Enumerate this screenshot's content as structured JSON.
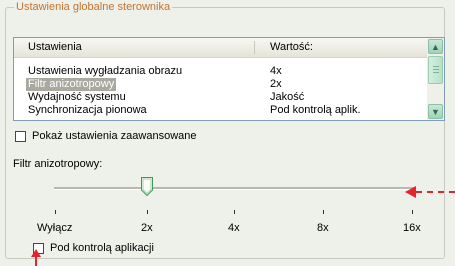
{
  "group": {
    "title": "Ustawienia globalne sterownika"
  },
  "table": {
    "columns": [
      "Ustawienia",
      "Wartość:"
    ],
    "rows": [
      {
        "name": "Ustawienia wygładzania obrazu",
        "value": "4x"
      },
      {
        "name": "Filtr anizotropowy",
        "value": "2x"
      },
      {
        "name": "Wydajność systemu",
        "value": "Jakość"
      },
      {
        "name": "Synchronizacja pionowa",
        "value": "Pod kontrolą aplik."
      }
    ],
    "selected_row": 1
  },
  "advanced_checkbox": {
    "label": "Pokaż ustawienia zaawansowane",
    "checked": false
  },
  "slider": {
    "label": "Filtr anizotropowy:",
    "ticks": [
      "Wyłącz",
      "2x",
      "4x",
      "8x",
      "16x"
    ],
    "value": "2x"
  },
  "app_control_checkbox": {
    "label": "Pod kontrolą aplikacji",
    "checked": false
  },
  "colors": {
    "accent_title": "#c4742f",
    "annotation_arrow": "#e3242b",
    "selection": "#a9a9a0"
  },
  "icons": {
    "scroll_up": "triangle-up",
    "scroll_down": "triangle-down"
  }
}
